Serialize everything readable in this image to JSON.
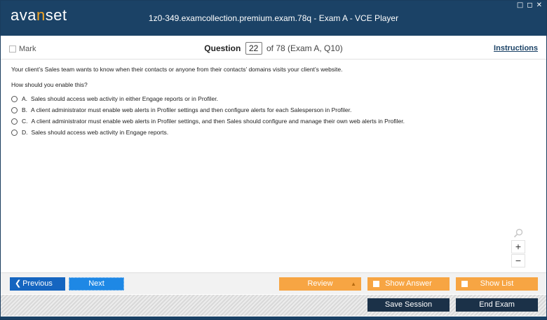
{
  "app": {
    "logo": {
      "part1": "ava",
      "part2": "n",
      "part3": "set"
    },
    "title": "1z0-349.examcollection.premium.exam.78q - Exam A - VCE Player",
    "window_controls": [
      "□",
      "◻",
      "✕"
    ]
  },
  "header": {
    "mark_label": "Mark",
    "question_label": "Question",
    "question_number": "22",
    "question_of": "of 78 (Exam A, Q10)",
    "instructions_label": "Instructions"
  },
  "question": {
    "text": "Your client’s Sales team wants to know when their contacts or anyone from their contacts’ domains visits your client’s website.",
    "prompt": "How should you enable this?",
    "options": [
      {
        "letter": "A.",
        "text": "Sales should access web activity in either Engage reports or in Profiler."
      },
      {
        "letter": "B.",
        "text": "A client administrator must enable web alerts in Profiler settings and then configure alerts for each Salesperson in Profiler."
      },
      {
        "letter": "C.",
        "text": "A client administrator must enable web alerts in Profiler settings, and then Sales should configure and manage their own web alerts in Profiler."
      },
      {
        "letter": "D.",
        "text": "Sales should access web activity in Engage reports."
      }
    ]
  },
  "zoom": {
    "plus": "+",
    "minus": "−"
  },
  "nav": {
    "previous_label": "Previous",
    "next_label": "Next",
    "review_label": "Review",
    "show_answer_label": "Show Answer",
    "show_list_label": "Show List"
  },
  "actions": {
    "save_label": "Save Session",
    "end_label": "End Exam"
  },
  "colors": {
    "titlebar": "#1b4266",
    "accent_orange": "#f7a543",
    "prev_blue": "#1565c0",
    "next_blue": "#1e88e5",
    "action_dark": "#1b3148"
  },
  "icons": {
    "search": "search-icon",
    "zoom_in": "plus-icon",
    "zoom_out": "minus-icon",
    "previous": "chevron-left-icon",
    "review": "triangle-up-icon"
  }
}
